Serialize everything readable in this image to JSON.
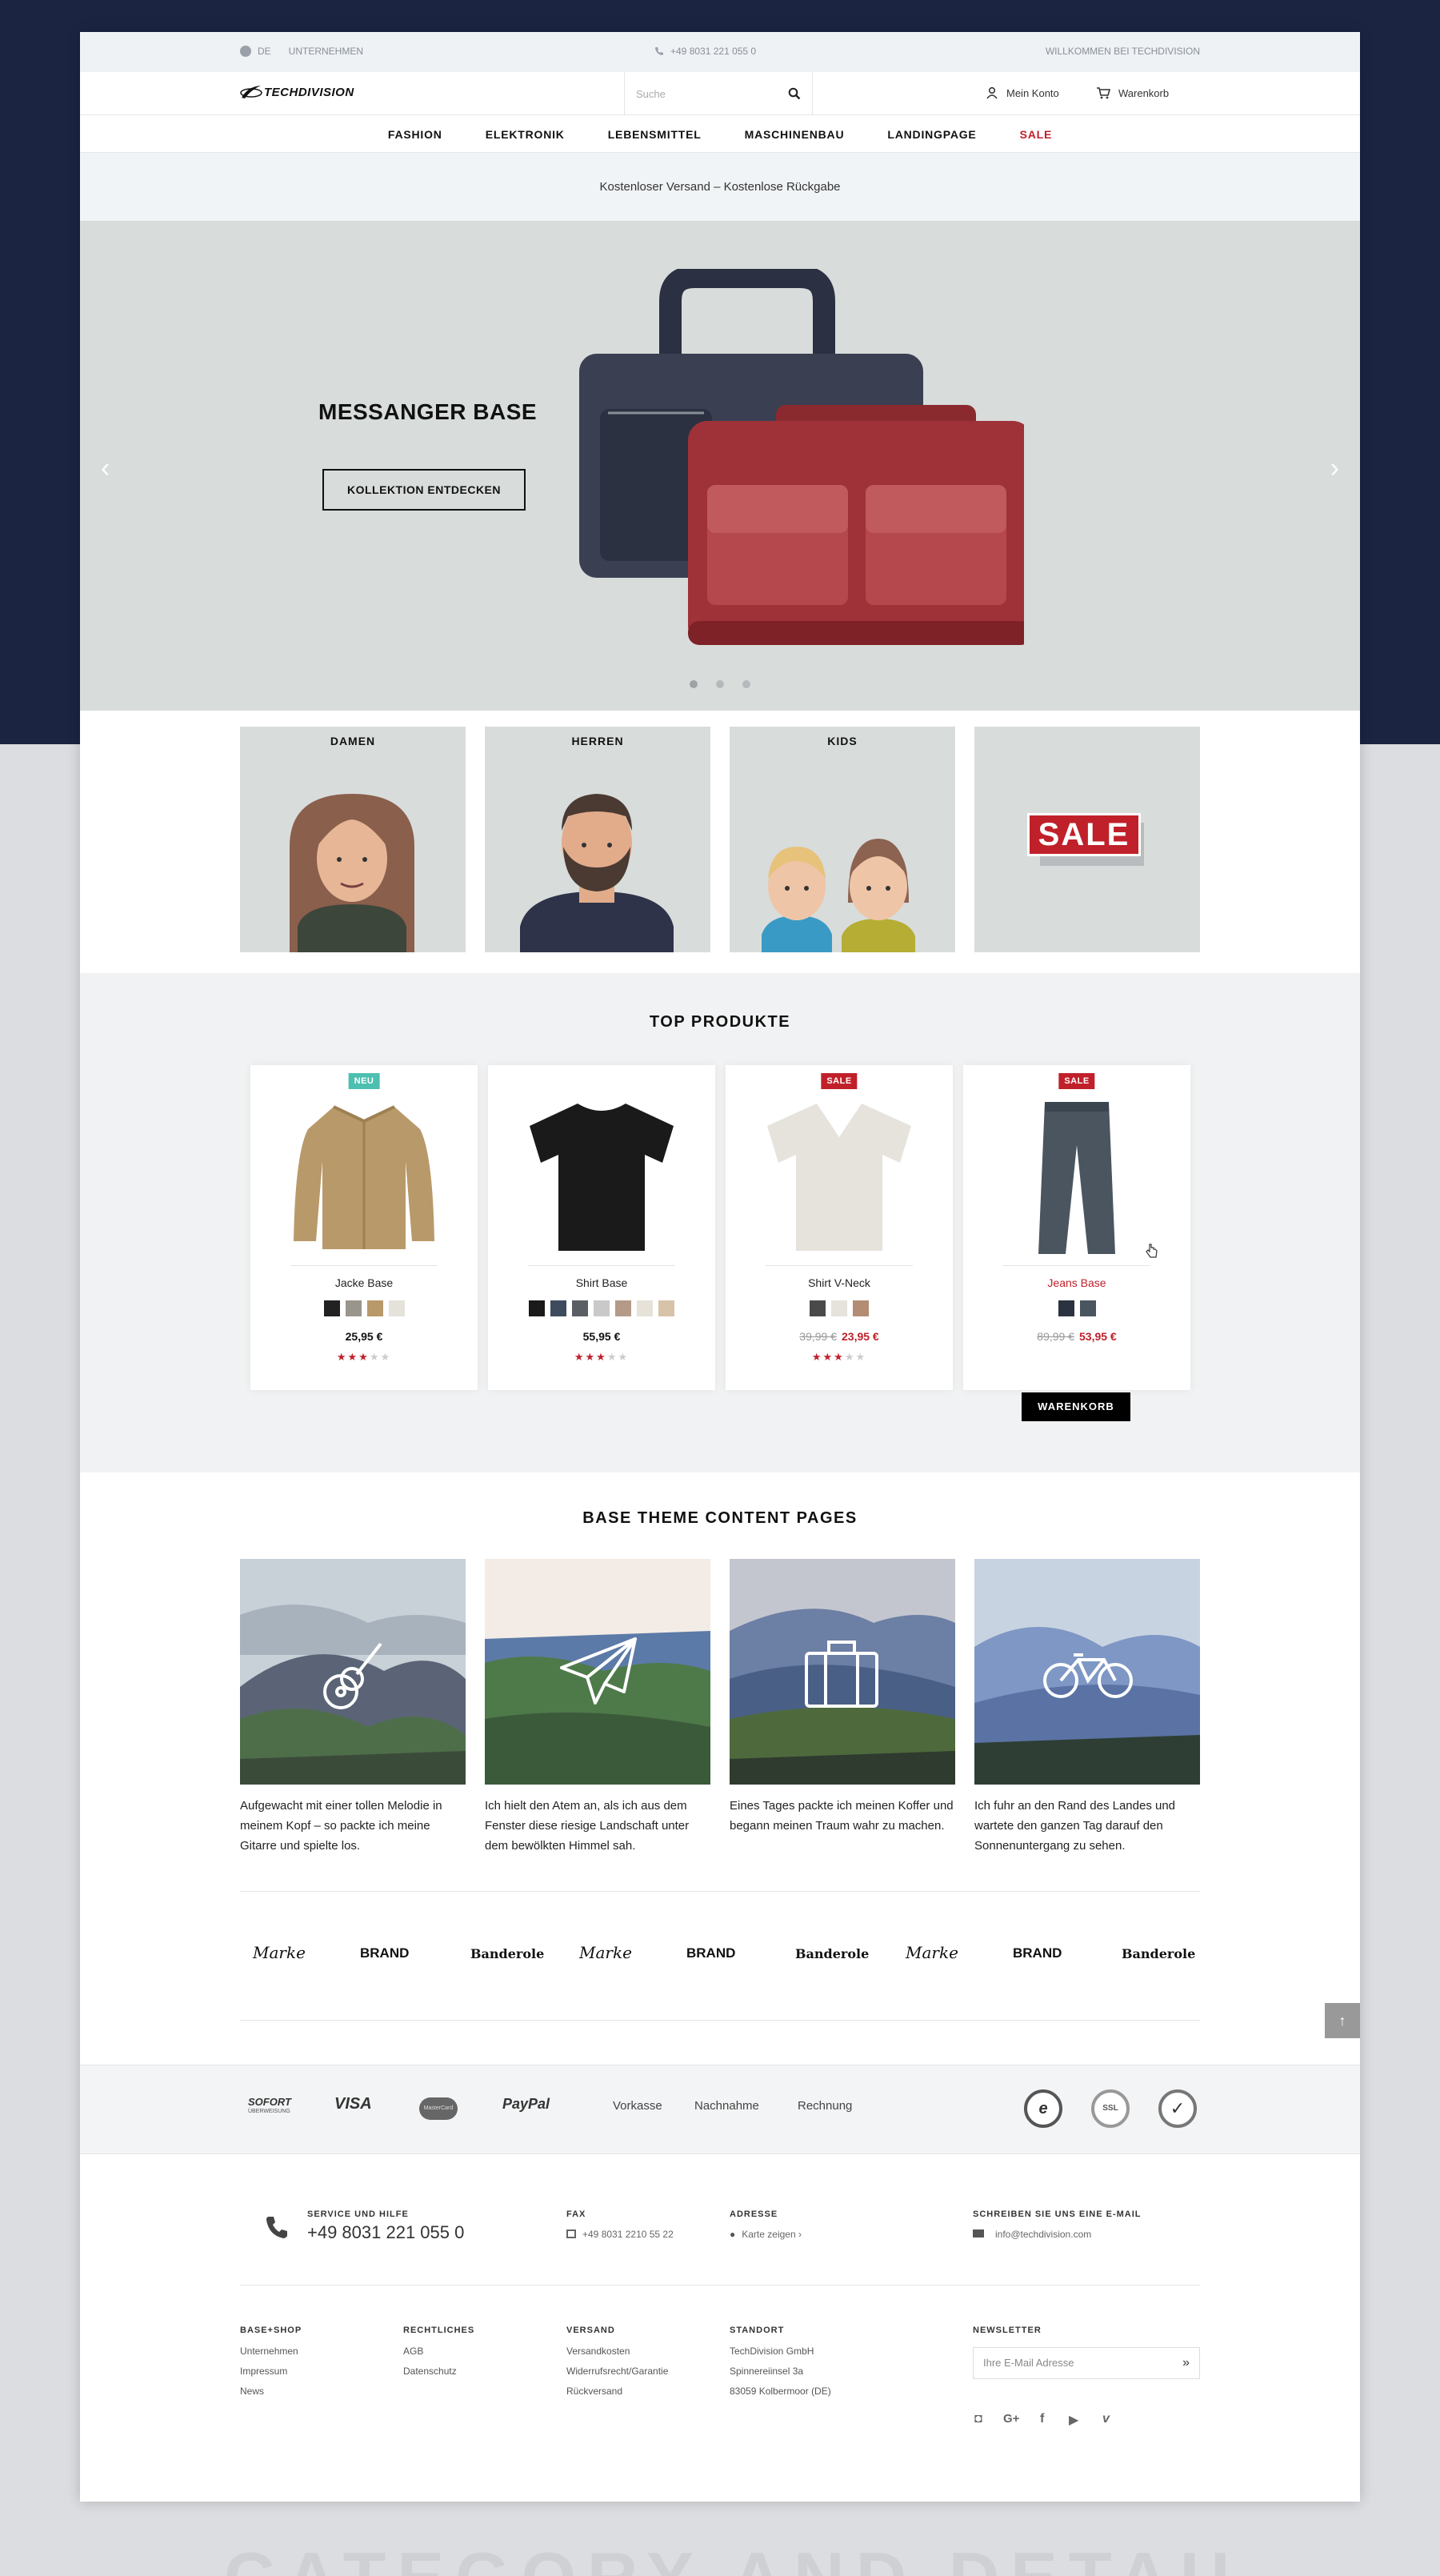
{
  "topbar": {
    "language": "DE",
    "company": "UNTERNEHMEN",
    "phone": "+49 8031 221 055 0",
    "welcome": "WILLKOMMEN BEI TECHDIVISION"
  },
  "header": {
    "logo_text": "TECHDIVISION",
    "search_placeholder": "Suche",
    "account_label": "Mein Konto",
    "cart_label": "Warenkorb"
  },
  "nav": {
    "items": [
      "FASHION",
      "ELEKTRONIK",
      "LEBENSMITTEL",
      "MASCHINENBAU",
      "LANDINGPAGE",
      "SALE"
    ]
  },
  "shipping_banner": "Kostenloser Versand – Kostenlose Rückgabe",
  "hero": {
    "title": "MESSANGER BASE",
    "button": "KOLLEKTION ENTDECKEN",
    "prev_arrow": "‹",
    "next_arrow": "›",
    "active_slide": 1,
    "slide_count": 3
  },
  "categories": [
    {
      "label": "DAMEN"
    },
    {
      "label": "HERREN"
    },
    {
      "label": "KIDS"
    },
    {
      "label": "",
      "sale_text": "SALE"
    }
  ],
  "top_products": {
    "title": "TOP PRODUKTE",
    "items": [
      {
        "badge": "NEU",
        "badge_color": "#4dbfb0",
        "name": "Jacke Base",
        "price": "25,95 €",
        "old_price": "",
        "new_price": "",
        "rating": 3,
        "swatches": [
          "#222222",
          "#9a958c",
          "#b8996a",
          "#e4e2da"
        ]
      },
      {
        "badge": "",
        "badge_color": "",
        "name": "Shirt Base",
        "price": "55,95 €",
        "old_price": "",
        "new_price": "",
        "rating": 3,
        "swatches": [
          "#1a1a1a",
          "#3e4a5e",
          "#5b5e63",
          "#c9c9c9",
          "#b59a88",
          "#e6e2d8",
          "#d7c3a8"
        ]
      },
      {
        "badge": "SALE",
        "badge_color": "#c0202a",
        "name": "Shirt V-Neck",
        "price": "",
        "old_price": "39,99 €",
        "new_price": "23,95 €",
        "rating": 3,
        "swatches": [
          "#4a4a4a",
          "#e6e3dc",
          "#b38c74"
        ]
      },
      {
        "badge": "SALE",
        "badge_color": "#c0202a",
        "name": "Jeans Base",
        "price": "",
        "old_price": "89,99 €",
        "new_price": "53,95 €",
        "rating": 0,
        "swatches": [
          "#2b3240",
          "#4a5560"
        ]
      }
    ],
    "cart_button": "WARENKORB"
  },
  "content_pages": {
    "title": "BASE THEME CONTENT PAGES",
    "items": [
      {
        "icon": "guitar-icon",
        "text": "Aufgewacht mit einer tollen Melodie in meinem Kopf – so packte ich meine Gitarre und spielte los."
      },
      {
        "icon": "paper-plane-icon",
        "text": "Ich hielt den Atem an, als ich aus dem Fenster diese riesige Landschaft unter dem bewölkten Himmel sah."
      },
      {
        "icon": "suitcase-icon",
        "text": "Eines Tages packte ich meinen Koffer und begann meinen Traum wahr zu machen."
      },
      {
        "icon": "bicycle-icon",
        "text": "Ich fuhr an den Rand des Landes und wartete den ganzen Tag darauf den Sonnenuntergang zu sehen."
      }
    ]
  },
  "brands": [
    "Marke",
    "BRAND",
    "Banderole",
    "Marke",
    "BRAND",
    "Banderole",
    "Marke",
    "BRAND",
    "Banderole"
  ],
  "payment": {
    "methods": [
      "SOFORT",
      "ÜBERWEISUNG",
      "VISA",
      "MasterCard",
      "PayPal",
      "Vorkasse",
      "Nachnahme",
      "Rechnung"
    ],
    "seals": [
      "e",
      "SSL",
      "✓"
    ]
  },
  "footer": {
    "service_head": "SERVICE UND HILFE",
    "service_phone": "+49 8031 221 055 0",
    "fax_head": "FAX",
    "fax_value": "+49 8031 2210 55 22",
    "address_head": "ADRESSE",
    "address_link": "Karte zeigen ›",
    "email_head": "SCHREIBEN SIE UNS EINE E-MAIL",
    "email_value": "info@techdivision.com",
    "columns": [
      {
        "head": "BASE+SHOP",
        "links": [
          "Unternehmen",
          "Impressum",
          "News"
        ]
      },
      {
        "head": "RECHTLICHES",
        "links": [
          "AGB",
          "Datenschutz"
        ]
      },
      {
        "head": "VERSAND",
        "links": [
          "Versandkosten",
          "Widerrufsrecht/Garantie",
          "Rückversand"
        ]
      },
      {
        "head": "STANDORT",
        "links": [
          "TechDivision GmbH",
          "Spinnereiinsel 3a",
          "83059 Kolbermoor (DE)"
        ]
      }
    ],
    "newsletter_head": "NEWSLETTER",
    "newsletter_placeholder": "Ihre E-Mail Adresse",
    "socials": [
      "instagram-icon",
      "google-plus-icon",
      "facebook-icon",
      "youtube-icon",
      "vimeo-icon"
    ]
  },
  "bottom_caption": "CATEGORY AND DETAIL PAGE"
}
